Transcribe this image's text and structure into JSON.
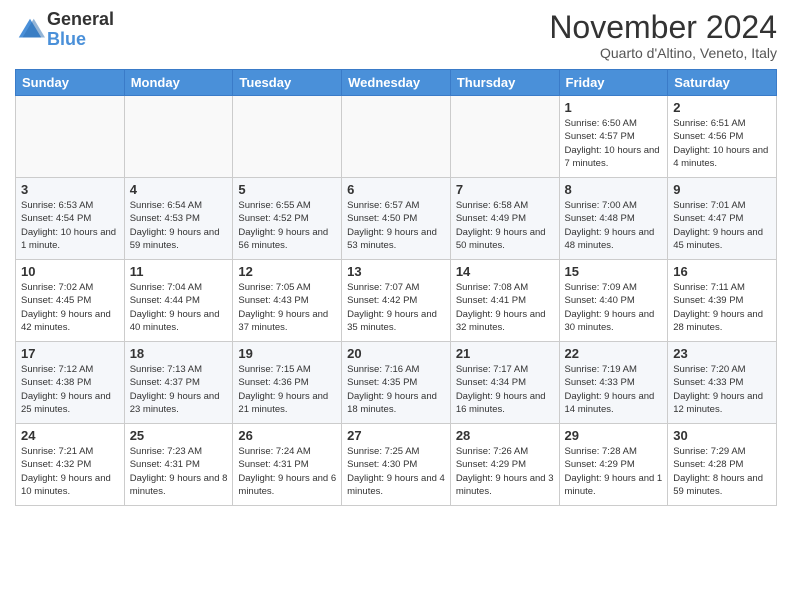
{
  "header": {
    "logo_general": "General",
    "logo_blue": "Blue",
    "month_title": "November 2024",
    "subtitle": "Quarto d'Altino, Veneto, Italy"
  },
  "days_of_week": [
    "Sunday",
    "Monday",
    "Tuesday",
    "Wednesday",
    "Thursday",
    "Friday",
    "Saturday"
  ],
  "weeks": [
    [
      {
        "day": "",
        "info": ""
      },
      {
        "day": "",
        "info": ""
      },
      {
        "day": "",
        "info": ""
      },
      {
        "day": "",
        "info": ""
      },
      {
        "day": "",
        "info": ""
      },
      {
        "day": "1",
        "info": "Sunrise: 6:50 AM\nSunset: 4:57 PM\nDaylight: 10 hours and 7 minutes."
      },
      {
        "day": "2",
        "info": "Sunrise: 6:51 AM\nSunset: 4:56 PM\nDaylight: 10 hours and 4 minutes."
      }
    ],
    [
      {
        "day": "3",
        "info": "Sunrise: 6:53 AM\nSunset: 4:54 PM\nDaylight: 10 hours and 1 minute."
      },
      {
        "day": "4",
        "info": "Sunrise: 6:54 AM\nSunset: 4:53 PM\nDaylight: 9 hours and 59 minutes."
      },
      {
        "day": "5",
        "info": "Sunrise: 6:55 AM\nSunset: 4:52 PM\nDaylight: 9 hours and 56 minutes."
      },
      {
        "day": "6",
        "info": "Sunrise: 6:57 AM\nSunset: 4:50 PM\nDaylight: 9 hours and 53 minutes."
      },
      {
        "day": "7",
        "info": "Sunrise: 6:58 AM\nSunset: 4:49 PM\nDaylight: 9 hours and 50 minutes."
      },
      {
        "day": "8",
        "info": "Sunrise: 7:00 AM\nSunset: 4:48 PM\nDaylight: 9 hours and 48 minutes."
      },
      {
        "day": "9",
        "info": "Sunrise: 7:01 AM\nSunset: 4:47 PM\nDaylight: 9 hours and 45 minutes."
      }
    ],
    [
      {
        "day": "10",
        "info": "Sunrise: 7:02 AM\nSunset: 4:45 PM\nDaylight: 9 hours and 42 minutes."
      },
      {
        "day": "11",
        "info": "Sunrise: 7:04 AM\nSunset: 4:44 PM\nDaylight: 9 hours and 40 minutes."
      },
      {
        "day": "12",
        "info": "Sunrise: 7:05 AM\nSunset: 4:43 PM\nDaylight: 9 hours and 37 minutes."
      },
      {
        "day": "13",
        "info": "Sunrise: 7:07 AM\nSunset: 4:42 PM\nDaylight: 9 hours and 35 minutes."
      },
      {
        "day": "14",
        "info": "Sunrise: 7:08 AM\nSunset: 4:41 PM\nDaylight: 9 hours and 32 minutes."
      },
      {
        "day": "15",
        "info": "Sunrise: 7:09 AM\nSunset: 4:40 PM\nDaylight: 9 hours and 30 minutes."
      },
      {
        "day": "16",
        "info": "Sunrise: 7:11 AM\nSunset: 4:39 PM\nDaylight: 9 hours and 28 minutes."
      }
    ],
    [
      {
        "day": "17",
        "info": "Sunrise: 7:12 AM\nSunset: 4:38 PM\nDaylight: 9 hours and 25 minutes."
      },
      {
        "day": "18",
        "info": "Sunrise: 7:13 AM\nSunset: 4:37 PM\nDaylight: 9 hours and 23 minutes."
      },
      {
        "day": "19",
        "info": "Sunrise: 7:15 AM\nSunset: 4:36 PM\nDaylight: 9 hours and 21 minutes."
      },
      {
        "day": "20",
        "info": "Sunrise: 7:16 AM\nSunset: 4:35 PM\nDaylight: 9 hours and 18 minutes."
      },
      {
        "day": "21",
        "info": "Sunrise: 7:17 AM\nSunset: 4:34 PM\nDaylight: 9 hours and 16 minutes."
      },
      {
        "day": "22",
        "info": "Sunrise: 7:19 AM\nSunset: 4:33 PM\nDaylight: 9 hours and 14 minutes."
      },
      {
        "day": "23",
        "info": "Sunrise: 7:20 AM\nSunset: 4:33 PM\nDaylight: 9 hours and 12 minutes."
      }
    ],
    [
      {
        "day": "24",
        "info": "Sunrise: 7:21 AM\nSunset: 4:32 PM\nDaylight: 9 hours and 10 minutes."
      },
      {
        "day": "25",
        "info": "Sunrise: 7:23 AM\nSunset: 4:31 PM\nDaylight: 9 hours and 8 minutes."
      },
      {
        "day": "26",
        "info": "Sunrise: 7:24 AM\nSunset: 4:31 PM\nDaylight: 9 hours and 6 minutes."
      },
      {
        "day": "27",
        "info": "Sunrise: 7:25 AM\nSunset: 4:30 PM\nDaylight: 9 hours and 4 minutes."
      },
      {
        "day": "28",
        "info": "Sunrise: 7:26 AM\nSunset: 4:29 PM\nDaylight: 9 hours and 3 minutes."
      },
      {
        "day": "29",
        "info": "Sunrise: 7:28 AM\nSunset: 4:29 PM\nDaylight: 9 hours and 1 minute."
      },
      {
        "day": "30",
        "info": "Sunrise: 7:29 AM\nSunset: 4:28 PM\nDaylight: 8 hours and 59 minutes."
      }
    ]
  ]
}
